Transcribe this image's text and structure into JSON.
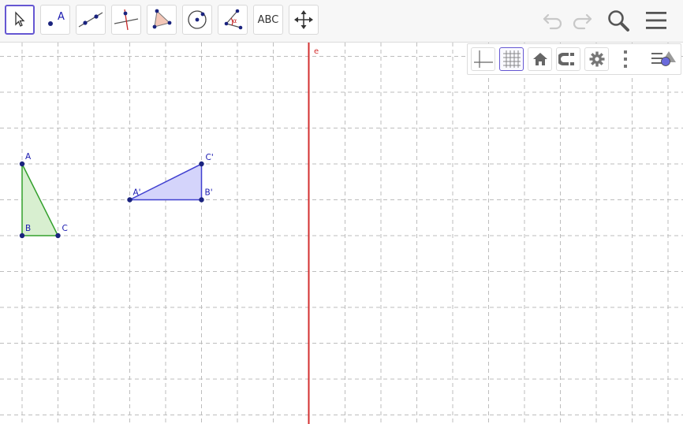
{
  "toolbar": {
    "tools": [
      {
        "name": "move-tool",
        "selected": true
      },
      {
        "name": "point-tool",
        "label": "A"
      },
      {
        "name": "line-tool"
      },
      {
        "name": "perpendicular-line-tool"
      },
      {
        "name": "polygon-tool"
      },
      {
        "name": "circle-tool"
      },
      {
        "name": "angle-tool",
        "label": "α"
      },
      {
        "name": "text-tool",
        "label": "ABC"
      },
      {
        "name": "move-graphics-view-tool"
      }
    ],
    "right_buttons": [
      "undo-icon",
      "redo-icon",
      "search-icon",
      "menu-icon"
    ]
  },
  "style_bar": {
    "buttons": [
      "axes-toggle-icon",
      "grid-toggle-icon",
      "home-icon",
      "magnet-snap-icon",
      "gear-icon",
      "more-options-icon",
      "toggle-algebra-view-icon"
    ],
    "grid_active": true
  },
  "graphics": {
    "line_label": "e",
    "triangle_original": {
      "labels": [
        "A",
        "B",
        "C"
      ],
      "vertices_grid": {
        "A": [
          0,
          0
        ],
        "B": [
          0,
          2
        ],
        "C": [
          1,
          2
        ]
      }
    },
    "triangle_image": {
      "labels": [
        "A'",
        "B'",
        "C'"
      ],
      "vertices_grid": {
        "A'": [
          3,
          1
        ],
        "B'": [
          5,
          1
        ],
        "C'": [
          5,
          0
        ]
      }
    }
  },
  "colors": {
    "accent": "#6557d2",
    "line_e": "#d32f2f",
    "original_fill": "#d8efd0",
    "original_stroke": "#33a02c",
    "image_fill": "#d4d4fb",
    "image_stroke": "#4040d0",
    "point": "#1a237e",
    "label": "#1a1ab0"
  }
}
